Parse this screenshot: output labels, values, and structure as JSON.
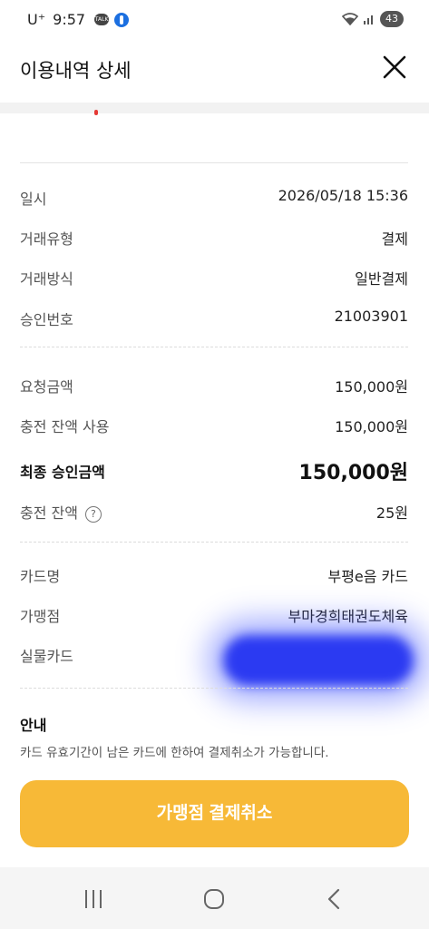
{
  "status_bar": {
    "carrier": "U⁺",
    "time": "9:57",
    "talk": "TALK",
    "battery": "43"
  },
  "header": {
    "title": "이용내역 상세"
  },
  "details": [
    {
      "label": "일시",
      "value": "2026/05/18 15:36"
    },
    {
      "label": "거래유형",
      "value": "결제"
    },
    {
      "label": "거래방식",
      "value": "일반결제"
    },
    {
      "label": "승인번호",
      "value": "21003901"
    }
  ],
  "amounts": [
    {
      "label": "요청금액",
      "value": "150,000원"
    },
    {
      "label": "충전 잔액 사용",
      "value": "150,000원"
    },
    {
      "label": "최종 승인금액",
      "value": "150,000원"
    },
    {
      "label": "충전 잔액",
      "value": "25원"
    }
  ],
  "card": [
    {
      "label": "카드명",
      "value": "부평e음 카드"
    },
    {
      "label": "가맹점",
      "value": "부마경희태권도체육"
    },
    {
      "label": "실물카드",
      "value": ""
    }
  ],
  "notice": {
    "title": "안내",
    "text": "카드 유효기간이 남은 카드에 한하여 결제취소가 가능합니다."
  },
  "actions": {
    "cancel_label": "가맹점 결제취소"
  },
  "colors": {
    "accent": "#f7b937",
    "redaction": "#2b3af2"
  }
}
